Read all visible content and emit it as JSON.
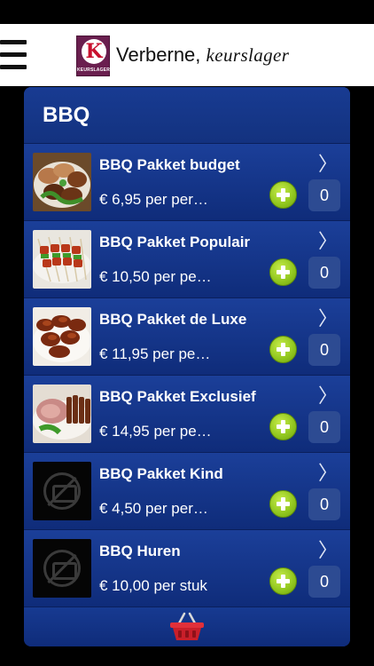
{
  "header": {
    "brand_name": "Verberne,",
    "brand_tagline": "keurslager",
    "logo_letter": "K",
    "logo_text": "KEURSLAGER",
    "menu_icon": "hamburger-menu-icon"
  },
  "category": {
    "title": "BBQ"
  },
  "products": [
    {
      "name": "BBQ Pakket budget",
      "price": "€ 6,95 per per…",
      "quantity": "0",
      "image": "meat-patties-photo"
    },
    {
      "name": "BBQ Pakket Populair",
      "price": "€ 10,50 per pe…",
      "quantity": "0",
      "image": "skewers-photo"
    },
    {
      "name": "BBQ Pakket de Luxe",
      "price": "€ 11,95 per pe…",
      "quantity": "0",
      "image": "grilled-meat-photo"
    },
    {
      "name": "BBQ Pakket Exclusief",
      "price": "€ 14,95 per pe…",
      "quantity": "0",
      "image": "sliced-roast-photo"
    },
    {
      "name": "BBQ Pakket Kind",
      "price": "€ 4,50 per per…",
      "quantity": "0",
      "image": "no-photo-icon"
    },
    {
      "name": "BBQ Huren",
      "price": "€ 10,00 per stuk",
      "quantity": "0",
      "image": "no-photo-icon"
    }
  ],
  "footer": {
    "basket_icon": "shopping-basket-icon"
  },
  "colors": {
    "panel": "#0f2c7a",
    "add_button": "#8fc51d",
    "basket": "#d8262e",
    "logo": "#6a1f4f"
  }
}
